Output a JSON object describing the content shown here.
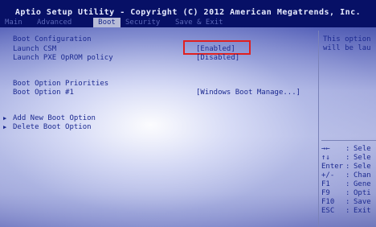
{
  "header": {
    "title": "Aptio Setup Utility - Copyright (C) 2012 American Megatrends, Inc.",
    "tabs": [
      "Main",
      "Advanced",
      "Boot",
      "Security",
      "Save & Exit"
    ]
  },
  "boot": {
    "section_title": "Boot Configuration",
    "settings": [
      {
        "label": "Launch CSM",
        "value": "[Enabled]"
      },
      {
        "label": "Launch PXE OpROM policy",
        "value": "[Disabled]"
      }
    ],
    "priorities_title": "Boot Option Priorities",
    "boot_option_1": {
      "label": "Boot Option #1",
      "value": "[Windows Boot Manage...]"
    },
    "submenus": [
      "Add New Boot Option",
      "Delete Boot Option"
    ]
  },
  "help": {
    "description_lines": [
      "This option",
      "will be lau"
    ],
    "keys": [
      {
        "key": "→←",
        "sep": ":",
        "desc": "Sele"
      },
      {
        "key": "↑↓",
        "sep": ":",
        "desc": "Sele"
      },
      {
        "key": "Enter",
        "sep": ":",
        "desc": "Sele"
      },
      {
        "key": "+/-",
        "sep": ":",
        "desc": "Chan"
      },
      {
        "key": "F1",
        "sep": ":",
        "desc": "Gene"
      },
      {
        "key": "F9",
        "sep": ":",
        "desc": "Opti"
      },
      {
        "key": "F10",
        "sep": ":",
        "desc": "Save"
      },
      {
        "key": "ESC",
        "sep": ":",
        "desc": "Exit"
      }
    ]
  },
  "colors": {
    "bar_bg": "#071066",
    "text": "#1c2a90",
    "highlight": "#e02020"
  }
}
